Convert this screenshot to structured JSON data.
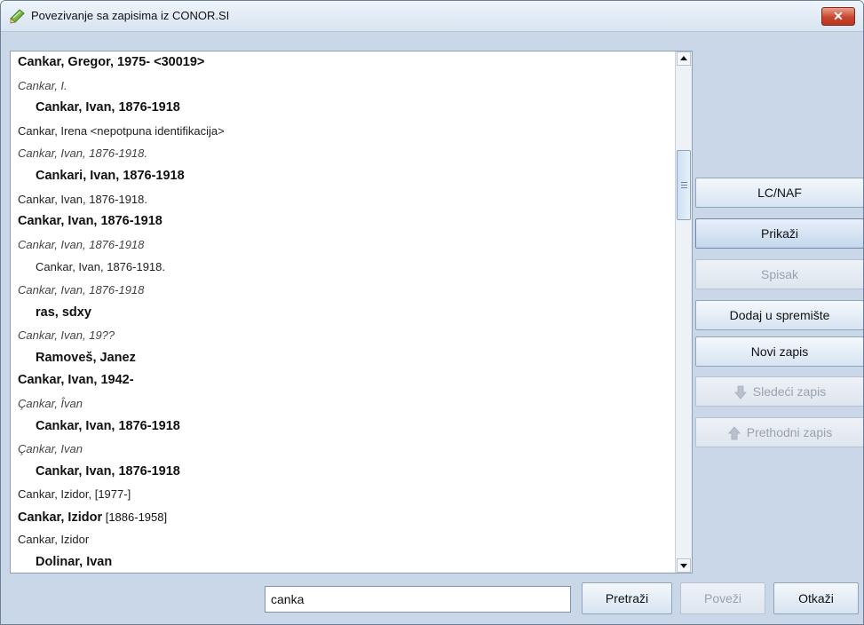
{
  "window": {
    "title": "Povezivanje sa zapisima iz CONOR.SI",
    "close_label": "✕"
  },
  "list": {
    "items": [
      {
        "parts": [
          {
            "text": "Cankar, Gregor, 1975- <30019>",
            "bold": true
          }
        ],
        "style": "bold",
        "indent": false
      },
      {
        "parts": [
          {
            "text": "Cankar, I."
          }
        ],
        "style": "italic",
        "indent": false
      },
      {
        "parts": [
          {
            "text": "Cankar, Ivan, 1876-1918",
            "bold": true
          }
        ],
        "style": "bold",
        "indent": true
      },
      {
        "parts": [
          {
            "text": "Cankar, Irena <nepotpuna identifikacija>"
          }
        ],
        "style": "normal",
        "indent": false
      },
      {
        "parts": [
          {
            "text": "Cankar, Ivan, 1876-1918."
          }
        ],
        "style": "italic",
        "indent": false
      },
      {
        "parts": [
          {
            "text": "Cankari, Ivan, 1876-1918",
            "bold": true
          }
        ],
        "style": "bold",
        "indent": true
      },
      {
        "parts": [
          {
            "text": "Cankar, Ivan, 1876-1918."
          }
        ],
        "style": "normal",
        "indent": false
      },
      {
        "parts": [
          {
            "text": "Cankar, Ivan, 1876-1918",
            "bold": true
          }
        ],
        "style": "bold",
        "indent": false
      },
      {
        "parts": [
          {
            "text": "Cankar, Ivan, 1876-1918"
          }
        ],
        "style": "italic",
        "indent": false
      },
      {
        "parts": [
          {
            "text": "Cankar, Ivan, 1876-1918."
          }
        ],
        "style": "normal",
        "indent": true
      },
      {
        "parts": [
          {
            "text": "Cankar, Ivan, 1876-1918"
          }
        ],
        "style": "italic",
        "indent": false
      },
      {
        "parts": [
          {
            "text": "ras, sdxy",
            "bold": true
          }
        ],
        "style": "bold",
        "indent": true
      },
      {
        "parts": [
          {
            "text": "Cankar, Ivan, 19??"
          }
        ],
        "style": "italic",
        "indent": false
      },
      {
        "parts": [
          {
            "text": "Ramoveš, Janez",
            "bold": true
          }
        ],
        "style": "bold",
        "indent": true
      },
      {
        "parts": [
          {
            "text": "Cankar, Ivan, 1942-",
            "bold": true
          }
        ],
        "style": "bold",
        "indent": false
      },
      {
        "parts": [
          {
            "text": "Çankar, Îvan"
          }
        ],
        "style": "italic",
        "indent": false
      },
      {
        "parts": [
          {
            "text": "Cankar, Ivan, 1876-1918",
            "bold": true
          }
        ],
        "style": "bold",
        "indent": true
      },
      {
        "parts": [
          {
            "text": "Çankar, Ivan"
          }
        ],
        "style": "italic",
        "indent": false
      },
      {
        "parts": [
          {
            "text": "Cankar, Ivan, 1876-1918",
            "bold": true
          }
        ],
        "style": "bold",
        "indent": true
      },
      {
        "parts": [
          {
            "text": "Cankar, Izidor, [1977-]"
          }
        ],
        "style": "normal",
        "indent": false
      },
      {
        "parts": [
          {
            "text": "Cankar, Izidor",
            "bold": true
          },
          {
            "text": " [1886-1958]",
            "bold": false
          }
        ],
        "style": "bold",
        "indent": false
      },
      {
        "parts": [
          {
            "text": "Cankar, Izidor"
          }
        ],
        "style": "normal",
        "indent": false
      },
      {
        "parts": [
          {
            "text": "Dolinar, Ivan",
            "bold": true
          }
        ],
        "style": "bold",
        "indent": true
      }
    ],
    "scroll_position": 0.2
  },
  "side_buttons": {
    "lcnaf": "LC/NAF",
    "prikazi": "Prikaži",
    "spisak": "Spisak",
    "dodaj": "Dodaj u spremište",
    "novi": "Novi zapis",
    "sledeci": "Sledeći zapis",
    "prethodni": "Prethodni zapis"
  },
  "bottom": {
    "search_value": "canka",
    "pretrazi": "Pretraži",
    "povezi": "Poveži",
    "otkazi": "Otkaži"
  },
  "colors": {
    "accent": "#c9452d",
    "disabled_text": "#9aa3ad",
    "arrow_icon": "#b9c2cc"
  },
  "icons": {
    "title": "book-pencil-icon",
    "sledeci": "arrow-down-icon",
    "prethodni": "arrow-up-icon"
  }
}
